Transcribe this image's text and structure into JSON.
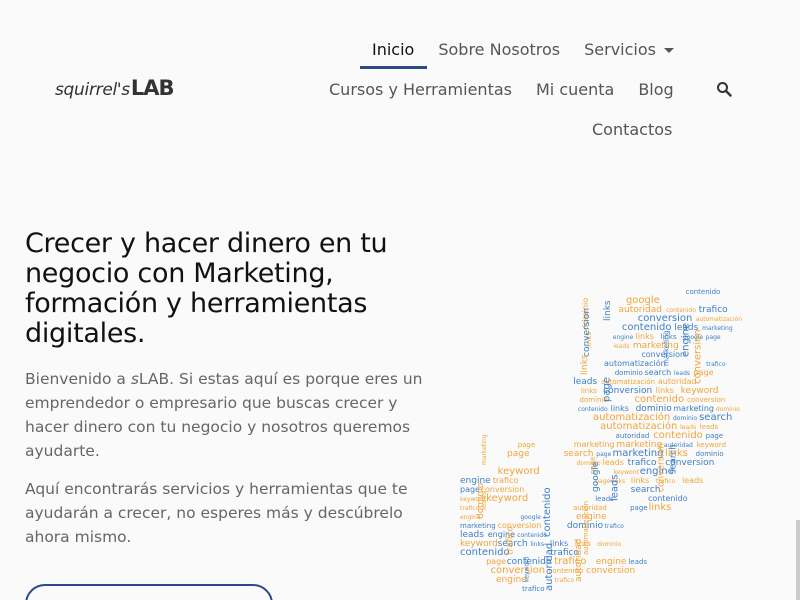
{
  "logo": {
    "script": "squirrel's",
    "bold": "LAB"
  },
  "nav": {
    "items": [
      "Inicio",
      "Sobre Nosotros",
      "Servicios",
      "Cursos y Herramientas",
      "Mi cuenta",
      "Blog",
      "Contactos"
    ]
  },
  "icons": {
    "search": "search-icon",
    "dropdown": "chevron-down-icon"
  },
  "hero": {
    "title": "Crecer y hacer dinero en tu negocio con Marketing, formación y herramientas digitales.",
    "p1_prefix": "Bienvenido a ",
    "p1_brand_s": "s",
    "p1_brand_lab": "LAB",
    "p1_rest": ". Si estas aquí es porque eres un emprendedor o empresario que buscas crecer y hacer dinero con tu negocio y nosotros queremos ayudarte.",
    "p2": "Aquí encontrarás servicios y herramientas que te ayudarán a crecer, no esperes más y descúbrelo ahora mismo."
  },
  "wordcloud": {
    "words": [
      "marketing",
      "leads",
      "google",
      "links",
      "search",
      "page",
      "contenido",
      "automatización",
      "dominio",
      "trafico",
      "autoridad",
      "engine",
      "conversion",
      "keyword"
    ]
  },
  "colors": {
    "accent": "#2c4a8a",
    "word_blue": "#3d7fc4",
    "word_orange": "#f0a53a"
  }
}
